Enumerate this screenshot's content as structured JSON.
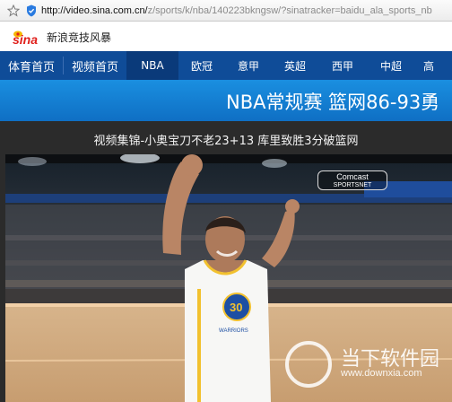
{
  "address_bar": {
    "url_host": "http://video.sina.com.cn/",
    "url_path": "z/sports/k/nba/140223bkngsw/?sinatracker=baidu_ala_sports_nb"
  },
  "logo": {
    "brand_text": "sina",
    "subtitle": "新浪竞技风暴"
  },
  "nav": {
    "items": [
      {
        "label": "体育首页"
      },
      {
        "label": "视频首页"
      },
      {
        "label": "NBA"
      },
      {
        "label": "欧冠"
      },
      {
        "label": "意甲"
      },
      {
        "label": "英超"
      },
      {
        "label": "西甲"
      },
      {
        "label": "中超"
      },
      {
        "label": "高"
      }
    ]
  },
  "banner": {
    "title": "NBA常规赛 篮网86-93勇"
  },
  "video": {
    "title": "视频集锦-小奥宝刀不老23+13 库里致胜3分破篮网",
    "channel_logo_line1": "Comcast",
    "channel_logo_line2": "SPORTSNET",
    "jersey_team": "WARRIORS",
    "jersey_number": "30"
  },
  "watermark": {
    "text": "当下软件园",
    "url": "www.downxia.com"
  },
  "colors": {
    "nav_bg": "#0f4c98",
    "banner_bg": "#1a8fe0",
    "dark_bg": "#2b2b2b",
    "sina_red": "#e0201c",
    "sina_yellow": "#f6b800"
  }
}
